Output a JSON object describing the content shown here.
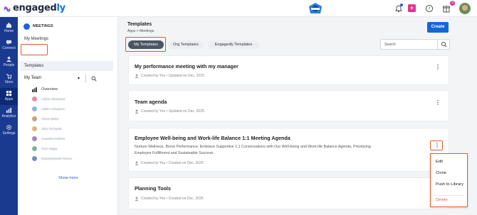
{
  "topbar": {
    "logo_main": "engaged",
    "logo_accent": "ly",
    "notification_count": "3",
    "plus_label": "+",
    "icons": [
      "grid-icon",
      "bell-icon",
      "plus-icon",
      "help-icon",
      "gift-icon"
    ]
  },
  "rail": {
    "items": [
      {
        "label": "Home"
      },
      {
        "label": "Connect"
      },
      {
        "label": "People"
      },
      {
        "label": "Store"
      },
      {
        "label": "Apps"
      },
      {
        "label": "Analytics"
      },
      {
        "label": "Settings"
      }
    ]
  },
  "sidebar": {
    "header": "MEETINGS",
    "my_meetings": "My Meetings",
    "templates": "Templates",
    "team_select": "My Team",
    "overview": "Overview",
    "members": [
      "Adrian Meadows",
      "Aidan Livingston",
      "Alexis Baker",
      "Alice Richards",
      "Anantha Krishna",
      "Arun Sagar",
      "DaisyDeborah Rivera"
    ],
    "member_colors": [
      "#e88aa0",
      "#8fb3d9",
      "#c9a07a",
      "#e7b07a",
      "#9c89c9",
      "#7fb49a",
      "#6f8fc2"
    ],
    "show_more": "Show more"
  },
  "main": {
    "title": "Templates",
    "breadcrumb": "Apps > Meetings",
    "create_label": "Create",
    "tabs": [
      "My Templates",
      "Org Templates",
      "Engagedly Templates"
    ],
    "search_placeholder": "Search",
    "cards": [
      {
        "title": "My performance meeting with my manager",
        "meta": "Created by You  •  Updated on Dec, 2025"
      },
      {
        "title": "Team agenda",
        "meta": "Created by You  •  Updated on Dec, 2025"
      },
      {
        "title": "Employee Well-being and Work-life Balance 1:1 Meeting Agenda",
        "description": "Nurture Wellness, Boost Performance: Embrace Supportive 1:1 Conversations with Our Well-being and Work-life Balance Agenda, Prioritizing Employee Fulfillment and Sustainable Success.",
        "meta": "Created by You  •  Created on Dec, 2025"
      },
      {
        "title": "Planning Tools",
        "meta": "Created by You  •  Created on Dec, 2025"
      }
    ],
    "kebab_glyph": "⋮",
    "menu": {
      "edit": "Edit",
      "clone": "Clone",
      "push": "Push to Library",
      "delete": "Delete"
    }
  },
  "colors": {
    "accent": "#1565d8",
    "rail": "#1a3a8f",
    "highlight": "#e05a2b",
    "delete": "#e25b55"
  }
}
